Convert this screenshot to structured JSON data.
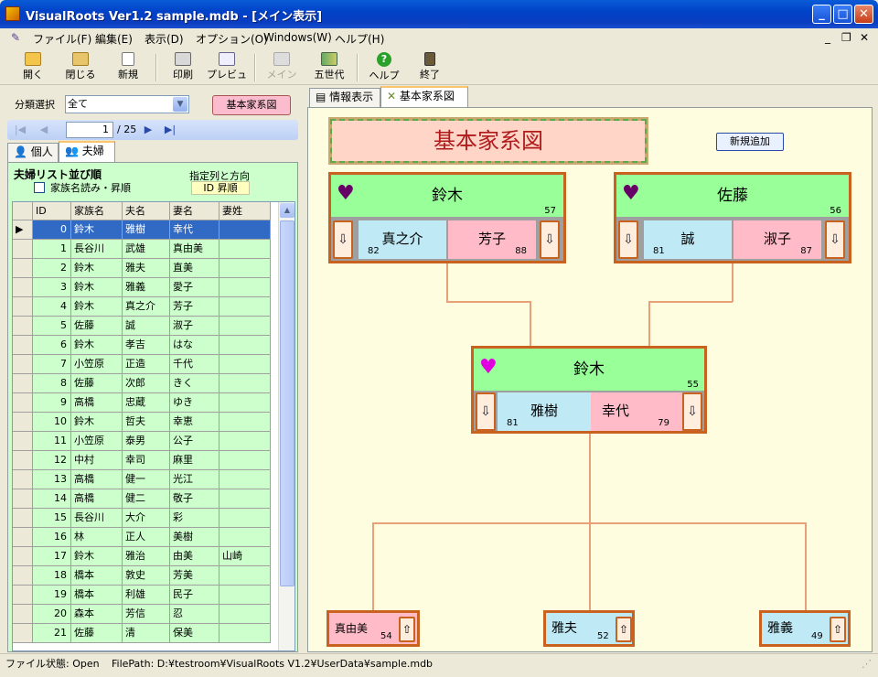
{
  "window": {
    "title": "VisualRoots Ver1.2  sample.mdb - [メイン表示]"
  },
  "menu": [
    "ファイル(F)",
    "編集(E)",
    "表示(D)",
    "オプション(O)",
    "Windows(W)",
    "ヘルプ(H)"
  ],
  "toolbar": {
    "open": "開く",
    "close": "閉じる",
    "new": "新規",
    "print": "印刷",
    "preview": "プレビュー",
    "main": "メイン",
    "five_gen": "五世代",
    "help": "ヘルプ",
    "exit": "終了"
  },
  "left": {
    "class_label": "分類選択",
    "class_value": "全て",
    "kihon_button": "基本家系図",
    "page_current": "1",
    "page_total": "/ 25",
    "tab_individual": "個人",
    "tab_couple": "夫婦",
    "sort_title": "夫婦リスト並び順",
    "sort_check_label": "家族名読み・昇順",
    "sort_dir_label": "指定列と方向",
    "sort_dir_value": "ID 昇順",
    "columns": [
      "ID",
      "家族名",
      "夫名",
      "妻名",
      "妻姓"
    ],
    "rows": [
      [
        "0",
        "鈴木",
        "雅樹",
        "幸代",
        ""
      ],
      [
        "1",
        "長谷川",
        "武雄",
        "真由美",
        ""
      ],
      [
        "2",
        "鈴木",
        "雅夫",
        "直美",
        ""
      ],
      [
        "3",
        "鈴木",
        "雅義",
        "愛子",
        ""
      ],
      [
        "4",
        "鈴木",
        "真之介",
        "芳子",
        ""
      ],
      [
        "5",
        "佐藤",
        "誠",
        "淑子",
        ""
      ],
      [
        "6",
        "鈴木",
        "孝吉",
        "はな",
        ""
      ],
      [
        "7",
        "小笠原",
        "正造",
        "千代",
        ""
      ],
      [
        "8",
        "佐藤",
        "次郎",
        "きく",
        ""
      ],
      [
        "9",
        "高橋",
        "忠蔵",
        "ゆき",
        ""
      ],
      [
        "10",
        "鈴木",
        "哲夫",
        "幸恵",
        ""
      ],
      [
        "11",
        "小笠原",
        "泰男",
        "公子",
        ""
      ],
      [
        "12",
        "中村",
        "幸司",
        "麻里",
        ""
      ],
      [
        "13",
        "高橋",
        "健一",
        "光江",
        ""
      ],
      [
        "14",
        "高橋",
        "健二",
        "敬子",
        ""
      ],
      [
        "15",
        "長谷川",
        "大介",
        "彩",
        ""
      ],
      [
        "16",
        "林",
        "正人",
        "美樹",
        ""
      ],
      [
        "17",
        "鈴木",
        "雅治",
        "由美",
        "山崎"
      ],
      [
        "18",
        "橋本",
        "敦史",
        "芳美",
        ""
      ],
      [
        "19",
        "橋本",
        "利雄",
        "民子",
        ""
      ],
      [
        "20",
        "森本",
        "芳信",
        "忍",
        ""
      ],
      [
        "21",
        "佐藤",
        "清",
        "保美",
        ""
      ]
    ]
  },
  "right": {
    "tab_info": "情報表示",
    "tab_kihon": "基本家系図",
    "chart_title": "基本家系図",
    "new_add_button": "新規追加",
    "couple_left": {
      "surname": "鈴木",
      "age": "57",
      "husband": "真之介",
      "husband_age": "82",
      "wife": "芳子",
      "wife_age": "88"
    },
    "couple_right": {
      "surname": "佐藤",
      "age": "56",
      "husband": "誠",
      "husband_age": "81",
      "wife": "淑子",
      "wife_age": "87"
    },
    "couple_main": {
      "surname": "鈴木",
      "age": "55",
      "husband": "雅樹",
      "husband_age": "81",
      "wife": "幸代",
      "wife_age": "79"
    },
    "children": [
      {
        "name": "真由美",
        "age": "54"
      },
      {
        "name": "雅夫",
        "age": "52"
      },
      {
        "name": "雅義",
        "age": "49"
      }
    ]
  },
  "status": {
    "file_state": "ファイル状態:  Open",
    "file_path": "FilePath:  D:¥testroom¥VisualRoots V1.2¥UserData¥sample.mdb"
  },
  "colors": {
    "title_bar": "#0a5bd6",
    "grid_bg": "#ccffcc",
    "canvas_bg": "#fffde0",
    "surname_bg": "#99ff99",
    "husband_bg": "#bfe9f5",
    "wife_bg": "#ffbcc8",
    "frame": "#c8621e"
  }
}
